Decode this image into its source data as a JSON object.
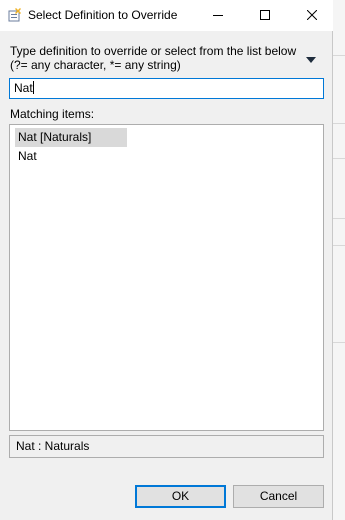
{
  "window": {
    "title": "Select Definition to Override",
    "icons": {
      "app": "override-icon",
      "minimize": "minimize-icon",
      "maximize": "maximize-icon",
      "close": "close-icon"
    }
  },
  "instructions": {
    "line1": "Type definition to override or select from the list below",
    "line2": "(?= any character, *= any string)",
    "menu_icon": "dropdown-triangle-icon"
  },
  "filter": {
    "value": "Nat"
  },
  "matching": {
    "label": "Matching items:",
    "items": [
      {
        "label": "Nat [Naturals]",
        "selected": true
      },
      {
        "label": "Nat",
        "selected": false
      }
    ]
  },
  "status": {
    "text": "Nat : Naturals"
  },
  "buttons": {
    "ok": "OK",
    "cancel": "Cancel"
  },
  "colors": {
    "accent": "#0078d7",
    "selection": "#d9d9d9",
    "background": "#f0f0f0"
  }
}
